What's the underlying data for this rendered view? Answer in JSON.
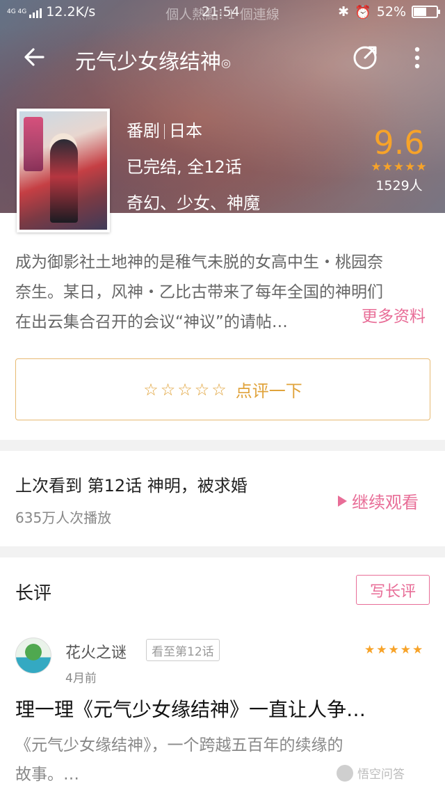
{
  "status_bar": {
    "network": "4G 4G",
    "speed": "12.2K/s",
    "carrier_overlay": "個人熱點: 1 個連線",
    "time": "21:54",
    "battery": "52%",
    "battery_level": 0.52
  },
  "nav": {
    "title": "元气少女缘结神",
    "title_mark": "◎"
  },
  "show": {
    "category": "番剧",
    "region": "日本",
    "status": "已完结, 全12话",
    "tags": "奇幻、少女、神魔",
    "score": "9.6",
    "rating_stars": 5,
    "stars_glyphs": "★★★★★",
    "raters": "1529人"
  },
  "synopsis": {
    "line1": "成为御影社土地神的是稚气未脱的女高中生・桃园奈",
    "line2": "奈生。某日，风神・乙比古带来了每年全国的神明们",
    "line3": "在出云集合召开的会议“神议”的请帖…",
    "more": "更多资料"
  },
  "rate_prompt": {
    "stars": "☆☆☆☆☆",
    "label": "点评一下"
  },
  "progress": {
    "title": "上次看到 第12话 神明，被求婚",
    "plays": "635万人次播放",
    "continue": "继续观看"
  },
  "long_review": {
    "heading": "长评",
    "write_button": "写长评",
    "reviewer": "花火之谜",
    "episode_badge": "看至第12话",
    "time": "4月前",
    "stars": "★★★★★",
    "rating": 5,
    "title": "理一理《元气少女缘结神》一直让人争…",
    "excerpt_line1": "《元气少女缘结神》，一个跨越五百年的续缘的",
    "excerpt_line2": "故事。…"
  },
  "watermark": {
    "text": "悟空问答"
  },
  "colors": {
    "accent_pink": "#e86d97",
    "score_orange": "#f7a329",
    "rate_gold": "#e0a33b"
  }
}
